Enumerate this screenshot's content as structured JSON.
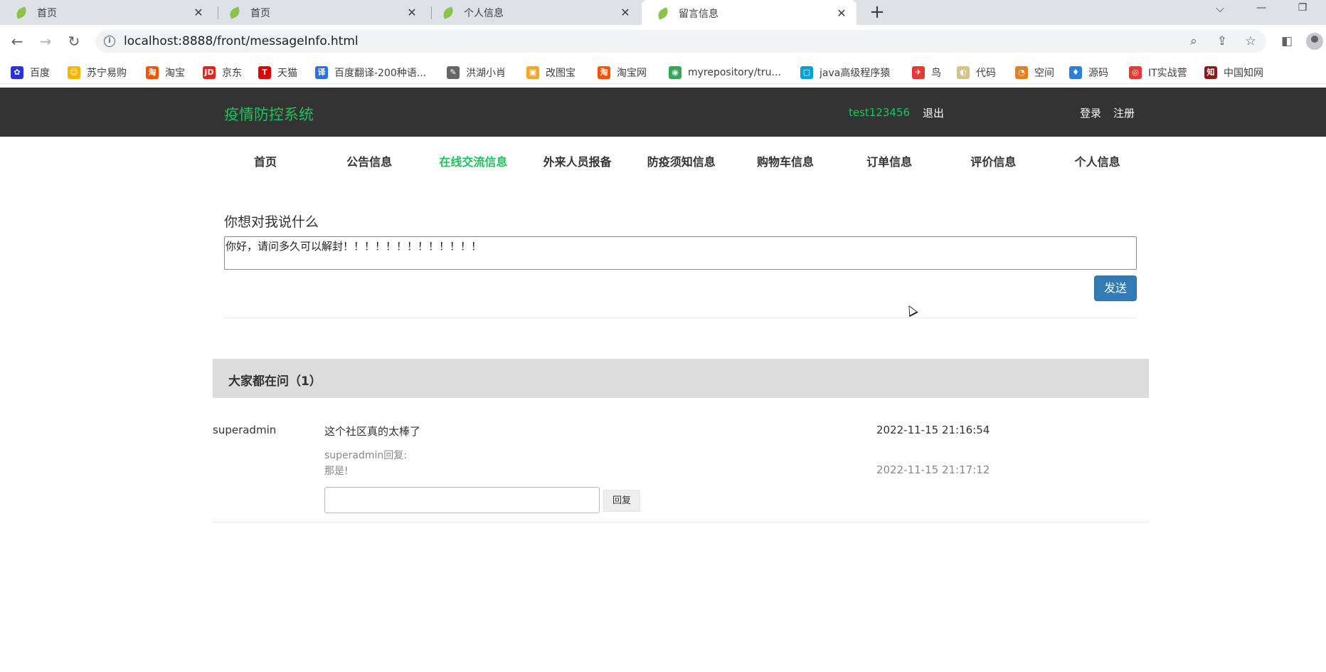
{
  "browser": {
    "tabs": [
      {
        "title": "首页",
        "active": false
      },
      {
        "title": "首页",
        "active": false
      },
      {
        "title": "个人信息",
        "active": false
      },
      {
        "title": "留言信息",
        "active": true
      }
    ],
    "close_glyph": "✕",
    "new_tab_glyph": "+",
    "url": "localhost:8888/front/messageInfo.html",
    "bookmarks": [
      {
        "label": "百度",
        "icon": "baidu-paw-icon",
        "color": "#2932e1",
        "glyph": "✿"
      },
      {
        "label": "苏宁易购",
        "icon": "suning-icon",
        "color": "#f7b500",
        "glyph": "☺"
      },
      {
        "label": "淘宝",
        "icon": "taobao-icon",
        "color": "#ff5000",
        "glyph": "淘"
      },
      {
        "label": "京东",
        "icon": "jd-icon",
        "color": "#e1251b",
        "glyph": "JD"
      },
      {
        "label": "天猫",
        "icon": "tmall-icon",
        "color": "#e00000",
        "glyph": "T"
      },
      {
        "label": "百度翻译-200种语...",
        "icon": "baidu-translate-icon",
        "color": "#2a6fe8",
        "glyph": "译"
      },
      {
        "label": "洪湖小肖",
        "icon": "hongtu-icon",
        "color": "#666666",
        "glyph": "✎"
      },
      {
        "label": "改图宝",
        "icon": "gaitubao-icon",
        "color": "#f5a623",
        "glyph": "▣"
      },
      {
        "label": "淘宝网",
        "icon": "taobao-net-icon",
        "color": "#ff5000",
        "glyph": "淘"
      },
      {
        "label": "myrepository/tru...",
        "icon": "chrome-icon",
        "color": "#34a853",
        "glyph": "◉"
      },
      {
        "label": "java高级程序猿",
        "icon": "bilibili-icon",
        "color": "#00a1d6",
        "glyph": "▢"
      },
      {
        "label": "鸟",
        "icon": "bird-icon",
        "color": "#e53935",
        "glyph": "✈"
      },
      {
        "label": "代码",
        "icon": "code-icon",
        "color": "#d4c48a",
        "glyph": "◐"
      },
      {
        "label": "空间",
        "icon": "qzone-icon",
        "color": "#e67e22",
        "glyph": "◔"
      },
      {
        "label": "源码",
        "icon": "source-icon",
        "color": "#2b7fd8",
        "glyph": "♦"
      },
      {
        "label": "IT实战营",
        "icon": "it-camp-icon",
        "color": "#e53935",
        "glyph": "◎"
      },
      {
        "label": "中国知网",
        "icon": "cnki-icon",
        "color": "#8b1a1a",
        "glyph": "知"
      }
    ]
  },
  "header": {
    "logo": "疫情防控系统",
    "username": "test123456",
    "logout": "退出",
    "login": "登录",
    "register": "注册"
  },
  "nav": {
    "items": [
      "首页",
      "公告信息",
      "在线交流信息",
      "外来人员报备",
      "防疫须知信息",
      "购物车信息",
      "订单信息",
      "评价信息",
      "个人信息"
    ],
    "active_index": 2
  },
  "message_form": {
    "label": "你想对我说什么",
    "value": "你好，请问多久可以解封！！！！！！！！！！！！！",
    "send": "发送"
  },
  "qa": {
    "title": "大家都在问（1）",
    "items": [
      {
        "user": "superadmin",
        "content": "这个社区真的太棒了",
        "time": "2022-11-15 21:16:54",
        "reply_by": "superadmin回复:",
        "reply_text": "那是!",
        "reply_time": "2022-11-15 21:17:12",
        "reply_button": "回复"
      }
    ]
  },
  "colors": {
    "brand_green": "#1cc35a",
    "header_bg": "#333333",
    "primary_button": "#337ab7"
  }
}
